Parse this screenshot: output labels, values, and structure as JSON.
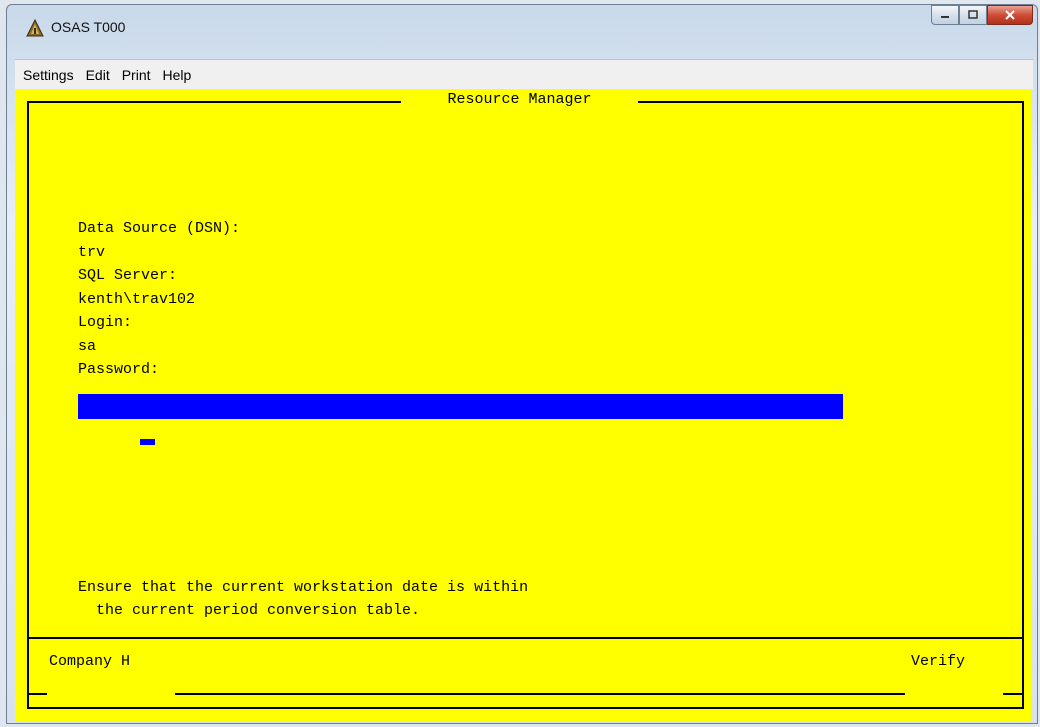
{
  "window": {
    "title": "OSAS T000",
    "icon": "osas-app-icon",
    "buttons": {
      "minimize": "minimize-icon",
      "maximize": "maximize-icon",
      "close": "close-icon"
    }
  },
  "menu": {
    "items": [
      "Settings",
      "Edit",
      "Print",
      "Help"
    ]
  },
  "screen": {
    "title": "Resource Manager",
    "background": "#ffff00",
    "accent": "#0000ff",
    "fields": {
      "dsn_label": "Data Source (DSN):",
      "dsn_value": "trv",
      "server_label": "SQL Server:",
      "server_value": "kenth\\trav102",
      "login_label": "Login:",
      "login_value": "sa",
      "password_label": "Password:",
      "password_value": ""
    },
    "message_line1": "Ensure that the current workstation date is within",
    "message_line2": "  the current period conversion table.",
    "footer_left": "Company H",
    "footer_right": "Verify"
  }
}
